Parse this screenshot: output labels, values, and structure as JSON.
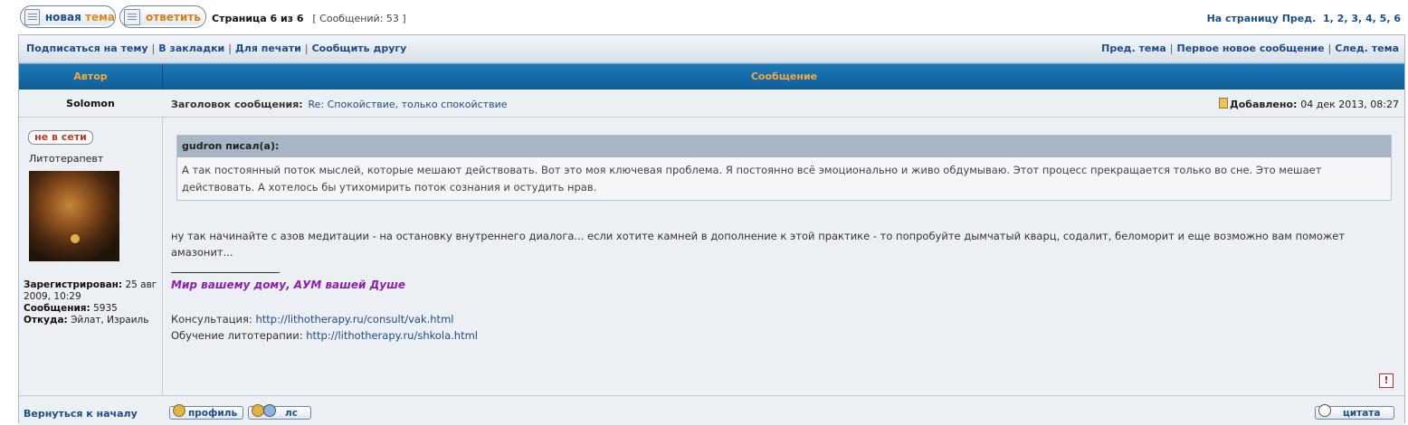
{
  "top": {
    "new_topic": [
      "новая",
      "тема"
    ],
    "reply": "ответить",
    "page_info": "Страница 6 из 6",
    "messages_count": "[ Сообщений: 53 ]",
    "to_page_label": "На страницу",
    "prev_label": "Пред.",
    "pages": [
      "1",
      "2",
      "3",
      "4",
      "5",
      "6"
    ]
  },
  "links_left": [
    "Подписаться на тему",
    "В закладки",
    "Для печати",
    "Сообщить другу"
  ],
  "links_right": [
    "Пред. тема",
    "Первое новое сообщение",
    "След. тема"
  ],
  "header": {
    "author": "Автор",
    "message": "Сообщение"
  },
  "post": {
    "author": "Solomon",
    "subject_label": "Заголовок сообщения:",
    "subject": "Re: Спокойствие, только спокойствие",
    "posted_label": "Добавлено:",
    "posted": "04 дек 2013, 08:27",
    "status": "не в сети",
    "rank": "Литотерапевт",
    "registered_label": "Зарегистрирован:",
    "registered": "25 авг 2009, 10:29",
    "messages_label": "Сообщения:",
    "messages": "5935",
    "from_label": "Откуда:",
    "from": "Эйлат, Израиль",
    "quote_author": "gudron писал(а):",
    "quote_text": "А так постоянный поток мыслей, которые мешают действовать. Вот это моя ключевая проблема. Я постоянно всё эмоционально и живо обдумываю. Этот процесс прекращается только во сне. Это мешает действовать. А хотелось бы утихомирить поток сознания и остудить нрав.",
    "text": "ну так начинайте с азов медитации - на остановку внутреннего диалога... если хотите камней в дополнение к этой практике - то попробуйте дымчатый кварц, содалит, беломорит и еще возможно вам поможет амазонит...",
    "motto": "Мир вашему дому, АУМ вашей Душе",
    "consult_label": "Консультация:",
    "consult_url": "http://lithotherapy.ru/consult/vak.html",
    "school_label": "Обучение литотерапии:",
    "school_url": "http://lithotherapy.ru/shkola.html",
    "report": "!"
  },
  "bottom": {
    "back_to_top": "Вернуться к началу",
    "profile": "профиль",
    "pm": "лс",
    "quote": "цитата"
  }
}
